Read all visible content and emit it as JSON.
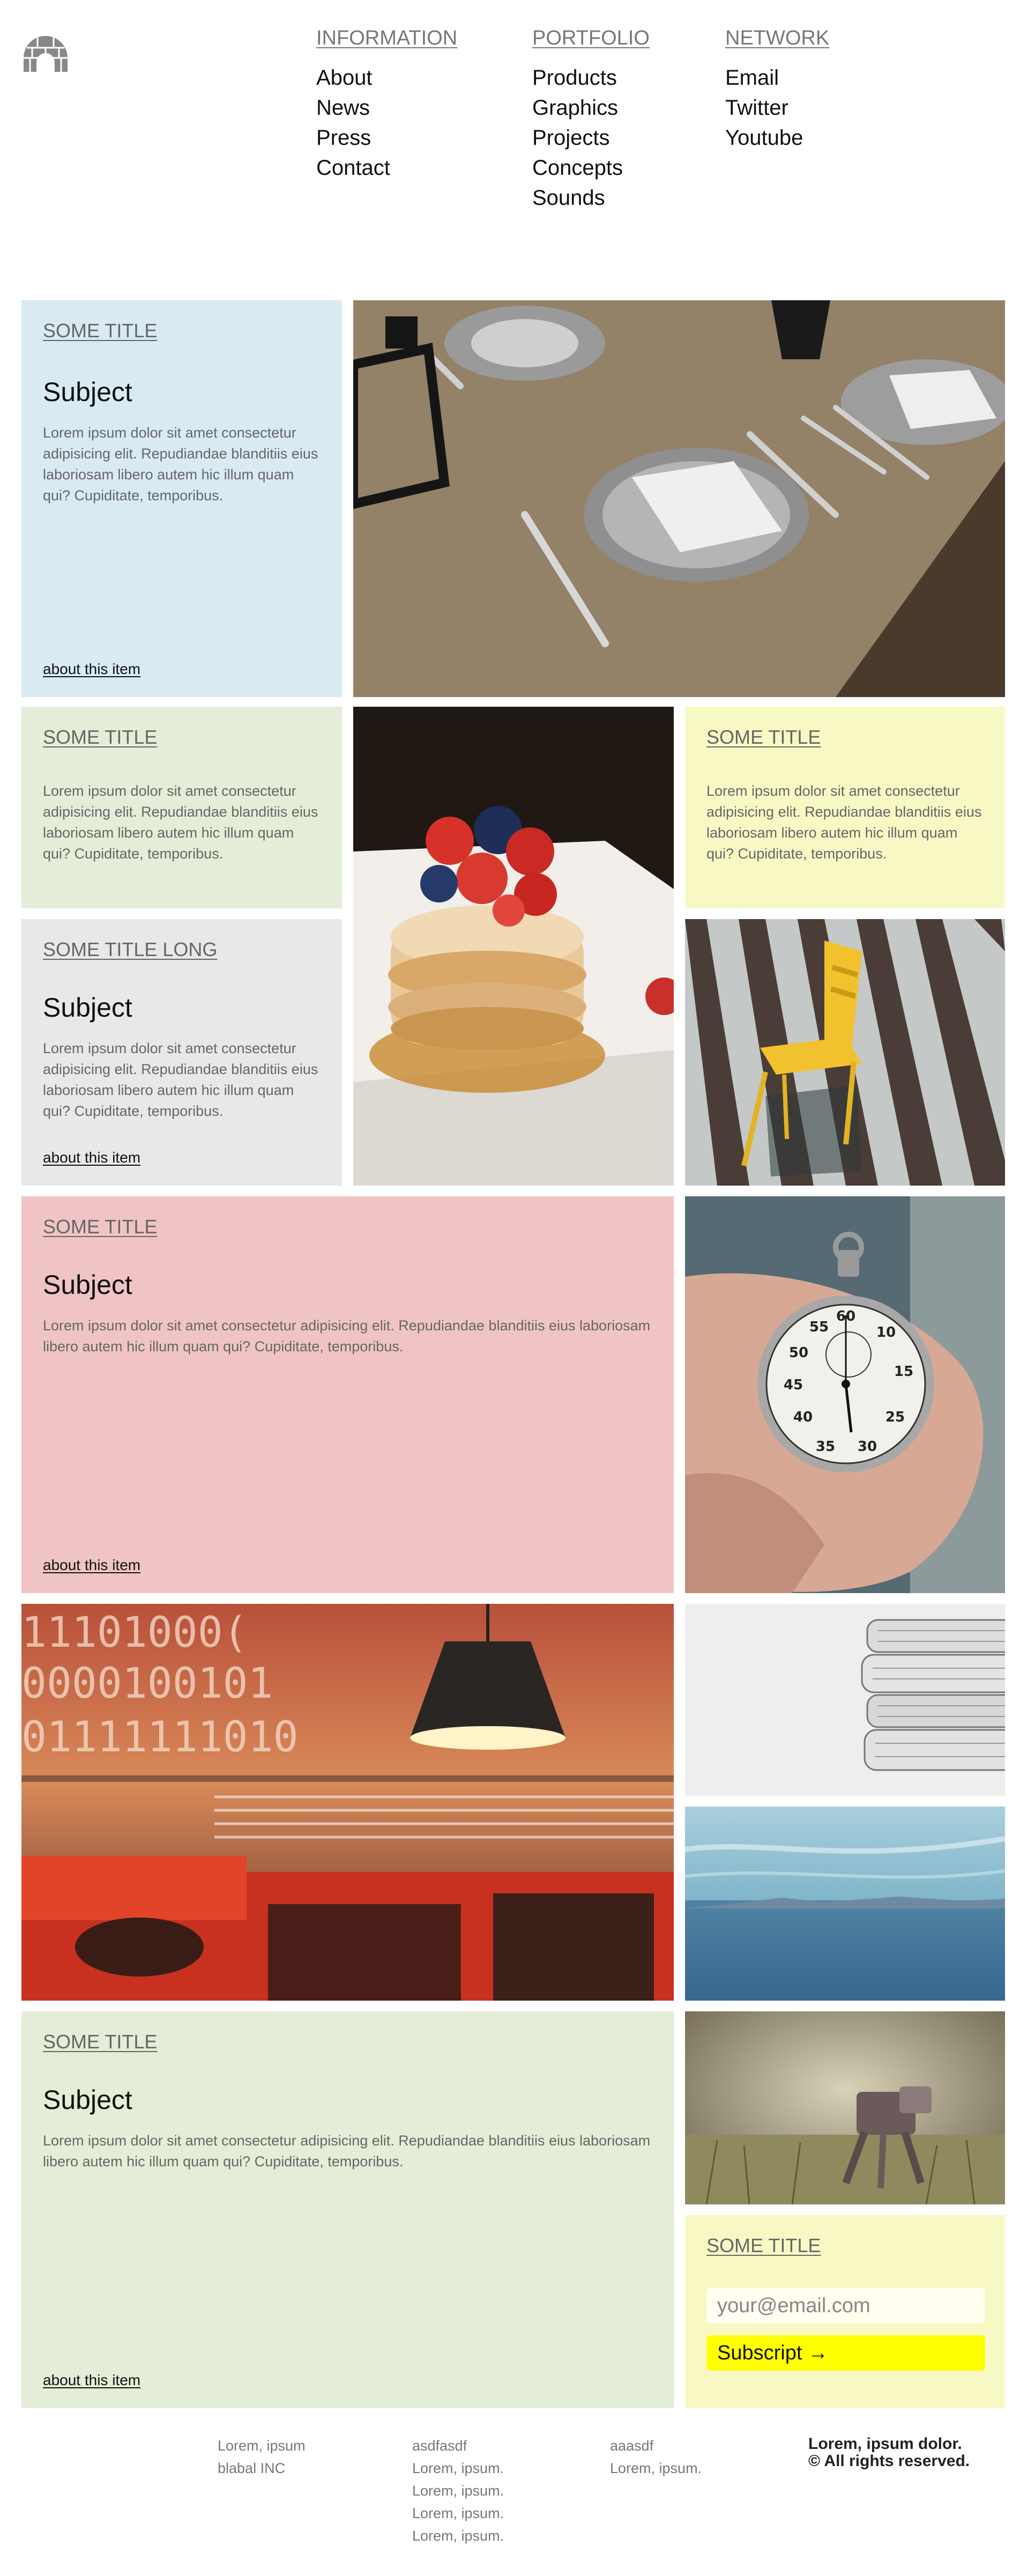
{
  "header": {
    "logo_icon": "igloo-logo-icon",
    "nav": [
      {
        "heading": "INFORMATION",
        "links": [
          "About",
          "News",
          "Press",
          "Contact"
        ]
      },
      {
        "heading": "PORTFOLIO",
        "links": [
          "Products",
          "Graphics",
          "Projects",
          "Concepts",
          "Sounds"
        ]
      },
      {
        "heading": "NETWORK",
        "links": [
          "Email",
          "Twitter",
          "Youtube"
        ]
      }
    ]
  },
  "cards": {
    "card1": {
      "title": "SOME TITLE",
      "subject": "Subject",
      "body": "Lorem ipsum dolor sit amet consectetur adipisicing elit. Repudiandae blanditiis eius laboriosam libero autem hic illum quam qui? Cupiditate, temporibus.",
      "link": "about this item"
    },
    "card2": {
      "title": "SOME TITLE",
      "body": "Lorem ipsum dolor sit amet consectetur adipisicing elit. Repudiandae blanditiis eius laboriosam libero autem hic illum quam qui? Cupiditate, temporibus."
    },
    "card3": {
      "title": "SOME TITLE",
      "body": "Lorem ipsum dolor sit amet consectetur adipisicing elit. Repudiandae blanditiis eius laboriosam libero autem hic illum quam qui? Cupiditate, temporibus."
    },
    "card4": {
      "title": "SOME TITLE LONG",
      "subject": "Subject",
      "body": "Lorem ipsum dolor sit amet consectetur adipisicing elit. Repudiandae blanditiis eius laboriosam libero autem hic illum quam qui? Cupiditate, temporibus.",
      "link": "about this item"
    },
    "card5": {
      "title": "SOME TITLE",
      "subject": "Subject",
      "body": "Lorem ipsum dolor sit amet consectetur adipisicing elit. Repudiandae blanditiis eius laboriosam libero autem hic illum quam qui? Cupiditate, temporibus.",
      "link": "about this item"
    },
    "card6": {
      "title": "SOME TITLE",
      "subject": "Subject",
      "body": "Lorem ipsum dolor sit amet consectetur adipisicing elit. Repudiandae blanditiis eius laboriosam libero autem hic illum quam qui? Cupiditate, temporibus.",
      "link": "about this item"
    }
  },
  "subscribe": {
    "title": "SOME TITLE",
    "email_placeholder": "your@email.com",
    "button_label": "Subscript →"
  },
  "photos": {
    "table_setting": "dining-table-photo",
    "pancakes": "pancakes-photo",
    "chair": "yellow-chair-photo",
    "stopwatch": "stopwatch-photo",
    "lamp": "lamp-binary-photo",
    "papers": "paper-stack-photo",
    "sky": "sky-horizon-photo",
    "robot": "toy-robot-photo"
  },
  "footer": {
    "columns": [
      [
        "Lorem, ipsum",
        "blabal INC"
      ],
      [
        "asdfasdf",
        "Lorem, ipsum.",
        "Lorem, ipsum.",
        "Lorem, ipsum.",
        "Lorem, ipsum."
      ],
      [
        "aaasdf",
        "Lorem, ipsum."
      ]
    ],
    "copyright": [
      "Lorem, ipsum dolor.",
      "© All rights reserved."
    ]
  },
  "colors": {
    "blue_card": "#d9eaf3",
    "green_card": "#e4edd7",
    "yellow_card": "#f8f8c5",
    "grey_card": "#e8e8e8",
    "pink_card": "#f0c4c4",
    "subscribe_button": "#ffff00"
  }
}
